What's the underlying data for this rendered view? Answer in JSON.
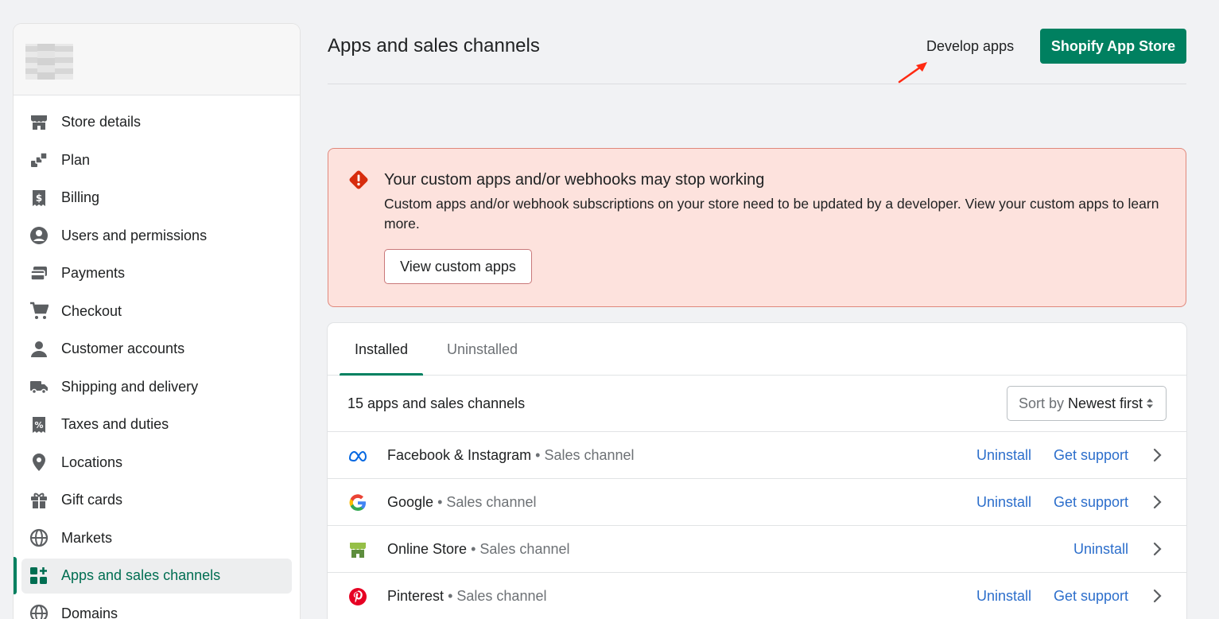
{
  "sidebar": {
    "items": [
      {
        "label": "Store details",
        "icon": "store-icon"
      },
      {
        "label": "Plan",
        "icon": "plan-icon"
      },
      {
        "label": "Billing",
        "icon": "billing-icon"
      },
      {
        "label": "Users and permissions",
        "icon": "user-circle-icon"
      },
      {
        "label": "Payments",
        "icon": "payments-icon"
      },
      {
        "label": "Checkout",
        "icon": "cart-icon"
      },
      {
        "label": "Customer accounts",
        "icon": "person-icon"
      },
      {
        "label": "Shipping and delivery",
        "icon": "truck-icon"
      },
      {
        "label": "Taxes and duties",
        "icon": "receipt-percent-icon"
      },
      {
        "label": "Locations",
        "icon": "location-pin-icon"
      },
      {
        "label": "Gift cards",
        "icon": "gift-icon"
      },
      {
        "label": "Markets",
        "icon": "globe-icon"
      },
      {
        "label": "Apps and sales channels",
        "icon": "apps-icon",
        "active": true
      },
      {
        "label": "Domains",
        "icon": "domains-globe-icon"
      }
    ]
  },
  "header": {
    "title": "Apps and sales channels",
    "develop_apps": "Develop apps",
    "app_store_button": "Shopify App Store"
  },
  "banner": {
    "title": "Your custom apps and/or webhooks may stop working",
    "body": "Custom apps and/or webhook subscriptions on your store need to be updated by a developer. View your custom apps to learn more.",
    "button": "View custom apps"
  },
  "tabs": {
    "installed": "Installed",
    "uninstalled": "Uninstalled"
  },
  "list": {
    "count": "15 apps and sales channels",
    "sort_prefix": "Sort by",
    "sort_value": "Newest first",
    "separator": "•",
    "uninstall": "Uninstall",
    "support": "Get support",
    "apps": [
      {
        "name": "Facebook & Instagram",
        "type": "Sales channel",
        "icon": "meta-icon",
        "support": true
      },
      {
        "name": "Google",
        "type": "Sales channel",
        "icon": "google-icon",
        "support": true
      },
      {
        "name": "Online Store",
        "type": "Sales channel",
        "icon": "online-store-icon",
        "support": false
      },
      {
        "name": "Pinterest",
        "type": "Sales channel",
        "icon": "pinterest-icon",
        "support": true
      }
    ]
  },
  "colors": {
    "accent": "#008060",
    "link": "#2c6ecb",
    "banner_bg": "#fde2dd",
    "critical": "#d72c0d",
    "annotation_arrow": "#ff2a12"
  }
}
